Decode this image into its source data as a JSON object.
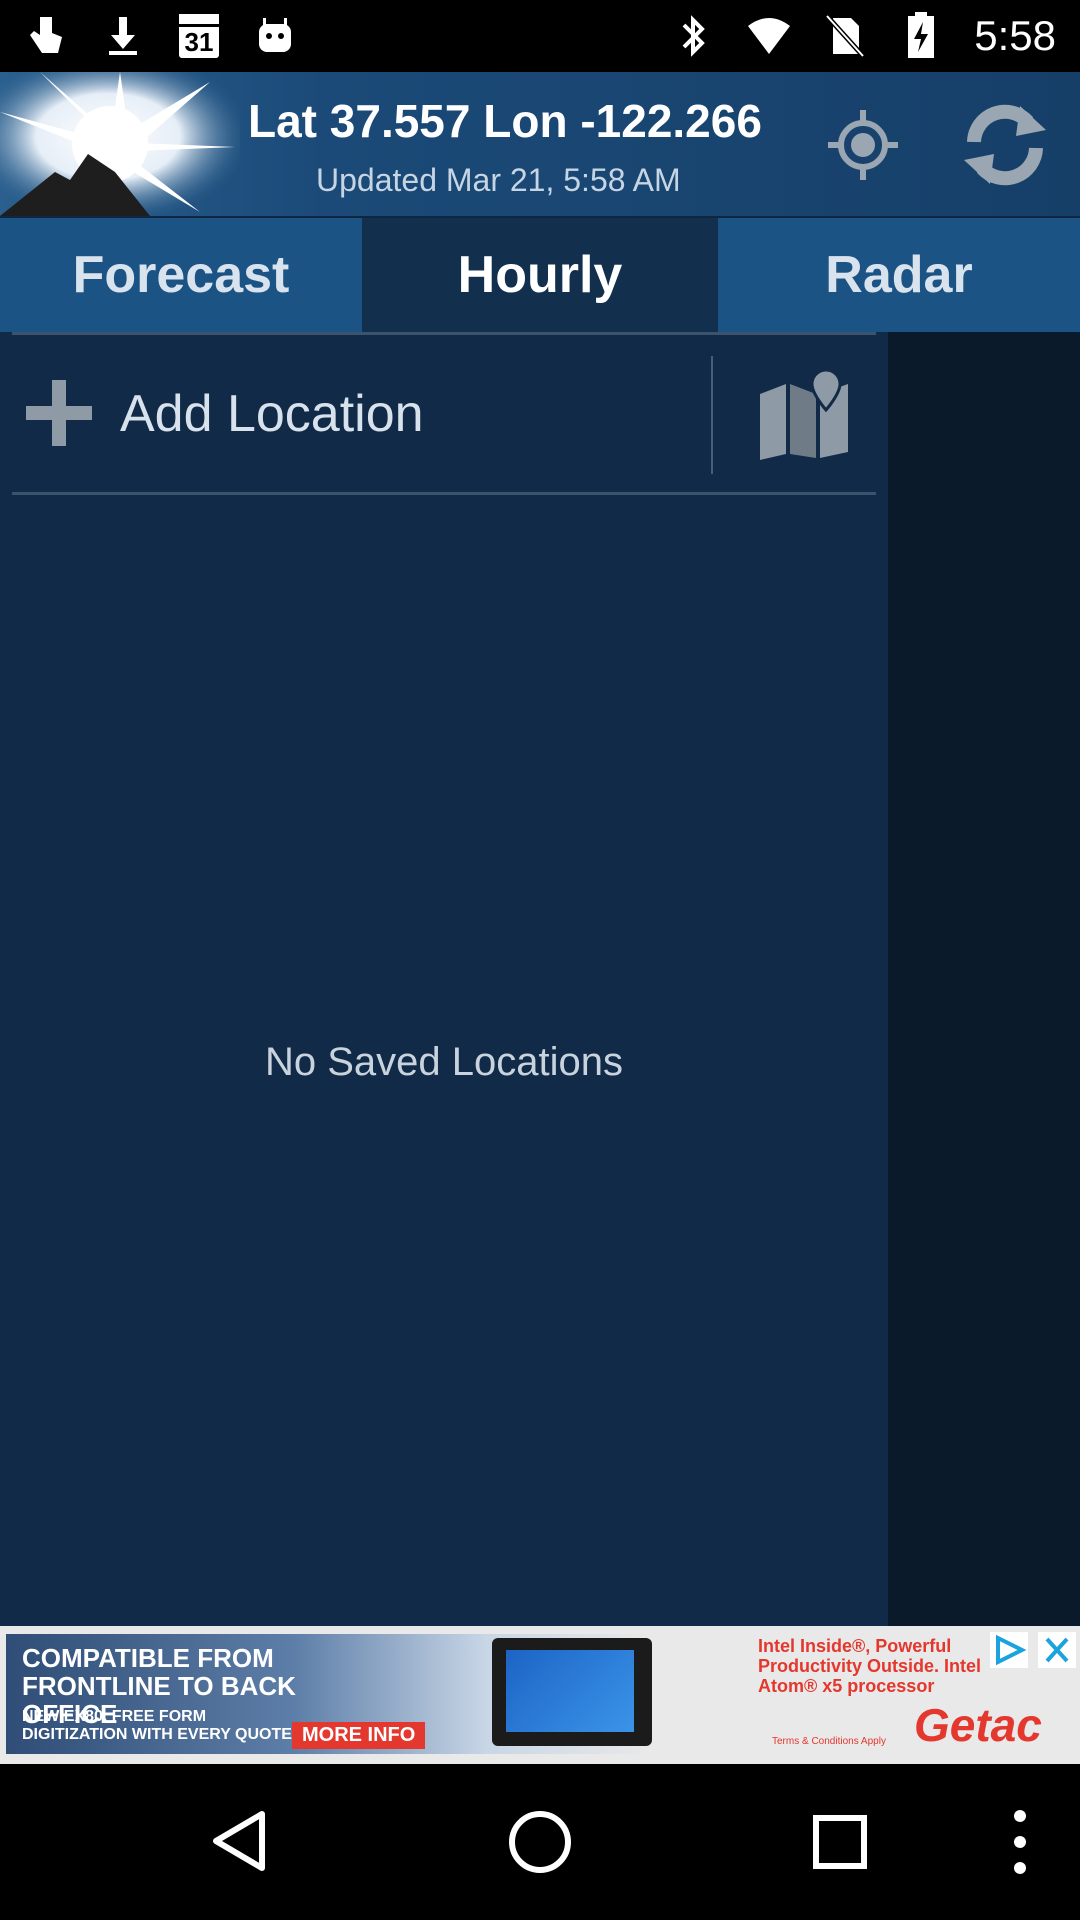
{
  "status_bar": {
    "time": "5:58",
    "calendar_day": "31",
    "left_icons": [
      "touch-icon",
      "download-icon",
      "calendar-icon",
      "android-icon"
    ],
    "right_icons": [
      "bluetooth-icon",
      "wifi-icon",
      "no-sim-icon",
      "battery-charging-icon"
    ]
  },
  "header": {
    "title": "Lat 37.557 Lon -122.266",
    "updated": "Updated Mar 21, 5:58 AM",
    "icons": [
      "sun-mountain-logo",
      "gps-icon",
      "refresh-icon"
    ]
  },
  "tabs": [
    {
      "label": "Forecast",
      "selected": false
    },
    {
      "label": "Hourly",
      "selected": true
    },
    {
      "label": "Radar",
      "selected": false
    }
  ],
  "drawer": {
    "add_location_label": "Add Location",
    "empty_message": "No Saved Locations"
  },
  "ad": {
    "headline": "COMPATIBLE FROM FRONTLINE TO BACK OFFICE",
    "subline": "NEW EX80. FREE FORM DIGITIZATION WITH EVERY QUOTE",
    "button": "MORE INFO",
    "right_text": "Intel Inside®, Powerful Productivity Outside. Intel Atom® x5 processor",
    "brand": "Getac",
    "terms": "Terms & Conditions Apply"
  },
  "colors": {
    "tab_active": "#132f4e",
    "tab_inactive": "#1c5385",
    "drawer_bg": "#112a47",
    "ad_accent": "#e4372d"
  }
}
